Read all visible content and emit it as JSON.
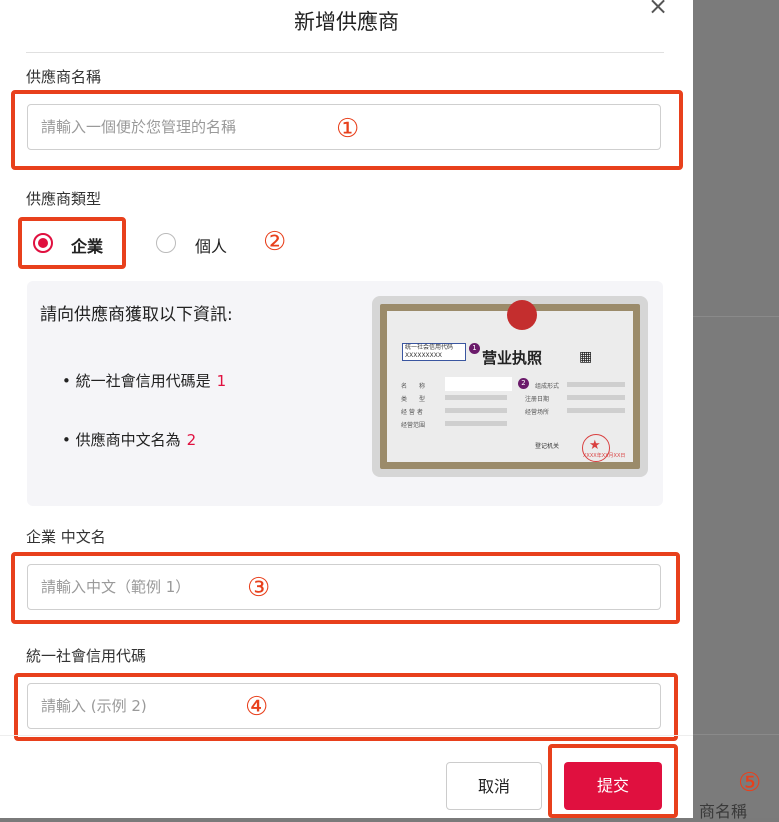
{
  "modal": {
    "title": "新增供應商",
    "close_symbol": "×"
  },
  "fields": {
    "supplier_name": {
      "label": "供應商名稱",
      "placeholder": "請輸入一個便於您管理的名稱",
      "value": ""
    },
    "supplier_type": {
      "label": "供應商類型",
      "options": [
        {
          "label": "企業",
          "selected": true
        },
        {
          "label": "個人",
          "selected": false
        }
      ]
    },
    "chinese_name": {
      "label": "企業 中文名",
      "placeholder": "請輸入中文（範例 1）",
      "value": ""
    },
    "credit_code": {
      "label": "統一社會信用代碼",
      "placeholder": "請輸入 (示例 2)",
      "value": ""
    }
  },
  "info": {
    "title": "請向供應商獲取以下資訊:",
    "items": [
      {
        "text": "統一社會信用代碼是",
        "num": "1"
      },
      {
        "text": "供應商中文名為",
        "num": "2"
      }
    ],
    "license": {
      "title": "营业执照",
      "code_label": "统一社会信用代码",
      "code_value": "XXXXXXXXX",
      "badge1": "1",
      "badge2": "2",
      "rows_left": [
        "名　　称",
        "类　　型",
        "经 营 者",
        "经营范围"
      ],
      "rows_right": [
        "组成形式",
        "注册日期",
        "经营场所"
      ],
      "reg_label": "登记机关",
      "seal_date": "XXXX年XX月XX日",
      "qr_symbol": "▦"
    }
  },
  "annotations": [
    "①",
    "②",
    "③",
    "④",
    "⑤"
  ],
  "buttons": {
    "cancel": "取消",
    "submit": "提交"
  },
  "background": {
    "partial_text": "商名稱"
  },
  "colors": {
    "accent": "#e0103f",
    "highlight": "#e8401c"
  }
}
